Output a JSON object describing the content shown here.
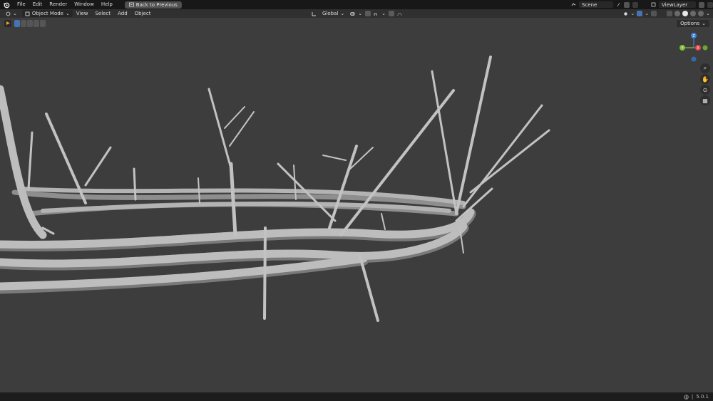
{
  "menubar": {
    "items": [
      "File",
      "Edit",
      "Render",
      "Window",
      "Help"
    ],
    "back_button": "Back to Previous",
    "scene_name": "Scene",
    "view_layer": "ViewLayer"
  },
  "header": {
    "mode": "Object Mode",
    "menus": [
      "View",
      "Select",
      "Add",
      "Object"
    ],
    "transform_orientation": "Global"
  },
  "toolbar": {
    "options_label": "Options"
  },
  "gizmo": {
    "axes": {
      "x": "X",
      "y": "Y",
      "z": "Z"
    },
    "colors": {
      "x": "#e04b4b",
      "y": "#7fc03c",
      "z": "#3d82d6"
    }
  },
  "viewport": {
    "object": "crown of thorns",
    "object_color": "#bdbdbd",
    "background": "#3d3d3d"
  },
  "statusbar": {
    "version": "5.0.1"
  }
}
